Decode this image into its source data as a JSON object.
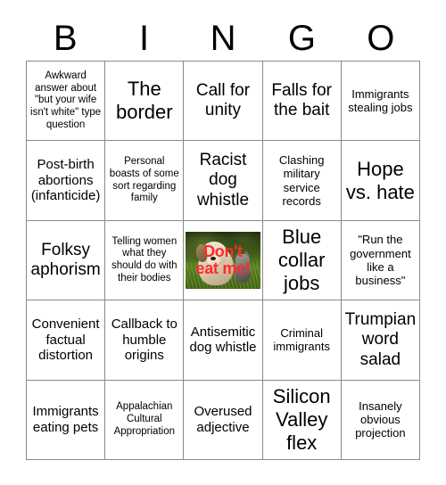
{
  "card": {
    "header_letters": [
      "B",
      "I",
      "N",
      "G",
      "O"
    ],
    "grid": [
      [
        {
          "text": "Awkward answer about \"but your wife isn't white\" type question",
          "size": "xs",
          "type": "text"
        },
        {
          "text": "The border",
          "size": "xl",
          "type": "text"
        },
        {
          "text": "Call for unity",
          "size": "lg",
          "type": "text"
        },
        {
          "text": "Falls for the bait",
          "size": "lg",
          "type": "text"
        },
        {
          "text": "Immigrants stealing jobs",
          "size": "sm",
          "type": "text"
        }
      ],
      [
        {
          "text": "Post-birth abortions (infanticide)",
          "size": "md",
          "type": "text"
        },
        {
          "text": "Personal boasts of some sort regarding family",
          "size": "xs",
          "type": "text"
        },
        {
          "text": "Racist dog whistle",
          "size": "lg",
          "type": "text"
        },
        {
          "text": "Clashing military service records",
          "size": "sm",
          "type": "text"
        },
        {
          "text": "Hope vs. hate",
          "size": "xl",
          "type": "text"
        }
      ],
      [
        {
          "text": "Folksy aphorism",
          "size": "lg",
          "type": "text"
        },
        {
          "text": "Telling women what they should do with their bodies",
          "size": "xs",
          "type": "text"
        },
        {
          "text": "Don't eat me!",
          "size": "md",
          "type": "image",
          "image_alt": "dog-and-kitten-photo",
          "caption_lines": [
            "Don't",
            "eat me!"
          ],
          "caption_color": "#ff2a2a"
        },
        {
          "text": "Blue collar jobs",
          "size": "xl",
          "type": "text"
        },
        {
          "text": "\"Run the government like a business\"",
          "size": "sm",
          "type": "text"
        }
      ],
      [
        {
          "text": "Convenient factual distortion",
          "size": "md",
          "type": "text"
        },
        {
          "text": "Callback to humble origins",
          "size": "md",
          "type": "text"
        },
        {
          "text": "Antisemitic dog whistle",
          "size": "md",
          "type": "text"
        },
        {
          "text": "Criminal immigrants",
          "size": "sm",
          "type": "text"
        },
        {
          "text": "Trumpian word salad",
          "size": "lg",
          "type": "text"
        }
      ],
      [
        {
          "text": "Immigrants eating pets",
          "size": "md",
          "type": "text"
        },
        {
          "text": "Appalachian Cultural Appropriation",
          "size": "xs",
          "type": "text"
        },
        {
          "text": "Overused adjective",
          "size": "md",
          "type": "text"
        },
        {
          "text": "Silicon Valley flex",
          "size": "xl",
          "type": "text"
        },
        {
          "text": "Insanely obvious projection",
          "size": "sm",
          "type": "text"
        }
      ]
    ]
  },
  "colors": {
    "background": "#ffffff",
    "text": "#000000",
    "grid_line": "#8a8a8a",
    "caption_red": "#ff2a2a"
  }
}
